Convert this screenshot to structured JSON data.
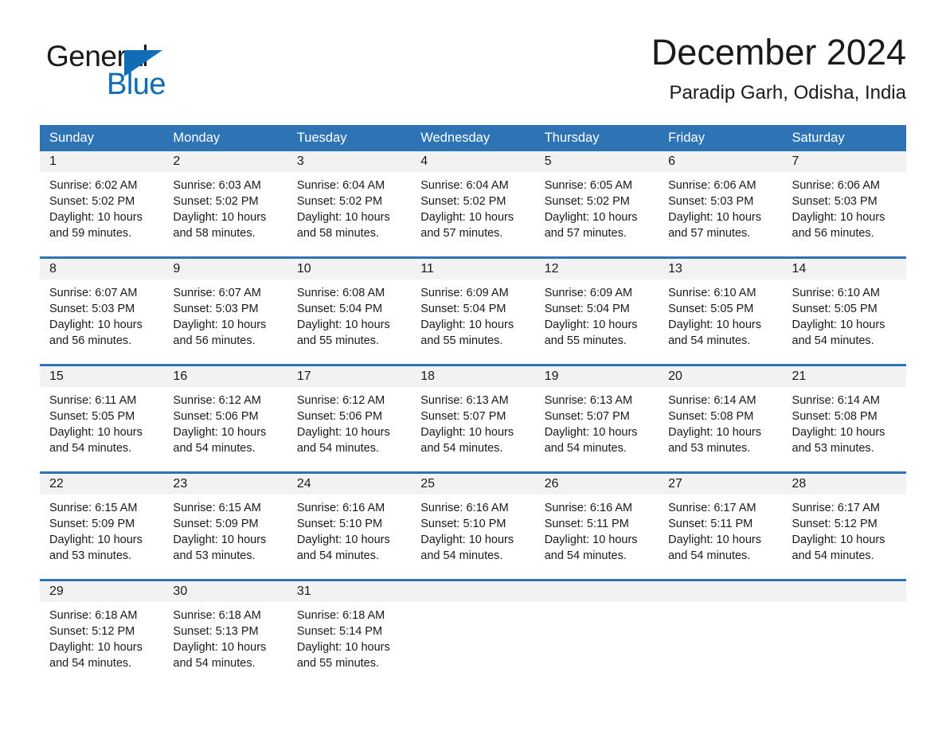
{
  "brand": {
    "name_part1": "General",
    "name_part2": "Blue",
    "triangle_color": "#0f6cb5"
  },
  "header": {
    "title": "December 2024",
    "location": "Paradip Garh, Odisha, India"
  },
  "theme": {
    "header_blue": "#2e74b5",
    "daynum_band": "#f2f2f2",
    "text": "#1a1a1a"
  },
  "weekdays": [
    "Sunday",
    "Monday",
    "Tuesday",
    "Wednesday",
    "Thursday",
    "Friday",
    "Saturday"
  ],
  "weeks": [
    [
      {
        "day": "1",
        "sunrise": "Sunrise: 6:02 AM",
        "sunset": "Sunset: 5:02 PM",
        "daylight_line1": "Daylight: 10 hours",
        "daylight_line2": "and 59 minutes."
      },
      {
        "day": "2",
        "sunrise": "Sunrise: 6:03 AM",
        "sunset": "Sunset: 5:02 PM",
        "daylight_line1": "Daylight: 10 hours",
        "daylight_line2": "and 58 minutes."
      },
      {
        "day": "3",
        "sunrise": "Sunrise: 6:04 AM",
        "sunset": "Sunset: 5:02 PM",
        "daylight_line1": "Daylight: 10 hours",
        "daylight_line2": "and 58 minutes."
      },
      {
        "day": "4",
        "sunrise": "Sunrise: 6:04 AM",
        "sunset": "Sunset: 5:02 PM",
        "daylight_line1": "Daylight: 10 hours",
        "daylight_line2": "and 57 minutes."
      },
      {
        "day": "5",
        "sunrise": "Sunrise: 6:05 AM",
        "sunset": "Sunset: 5:02 PM",
        "daylight_line1": "Daylight: 10 hours",
        "daylight_line2": "and 57 minutes."
      },
      {
        "day": "6",
        "sunrise": "Sunrise: 6:06 AM",
        "sunset": "Sunset: 5:03 PM",
        "daylight_line1": "Daylight: 10 hours",
        "daylight_line2": "and 57 minutes."
      },
      {
        "day": "7",
        "sunrise": "Sunrise: 6:06 AM",
        "sunset": "Sunset: 5:03 PM",
        "daylight_line1": "Daylight: 10 hours",
        "daylight_line2": "and 56 minutes."
      }
    ],
    [
      {
        "day": "8",
        "sunrise": "Sunrise: 6:07 AM",
        "sunset": "Sunset: 5:03 PM",
        "daylight_line1": "Daylight: 10 hours",
        "daylight_line2": "and 56 minutes."
      },
      {
        "day": "9",
        "sunrise": "Sunrise: 6:07 AM",
        "sunset": "Sunset: 5:03 PM",
        "daylight_line1": "Daylight: 10 hours",
        "daylight_line2": "and 56 minutes."
      },
      {
        "day": "10",
        "sunrise": "Sunrise: 6:08 AM",
        "sunset": "Sunset: 5:04 PM",
        "daylight_line1": "Daylight: 10 hours",
        "daylight_line2": "and 55 minutes."
      },
      {
        "day": "11",
        "sunrise": "Sunrise: 6:09 AM",
        "sunset": "Sunset: 5:04 PM",
        "daylight_line1": "Daylight: 10 hours",
        "daylight_line2": "and 55 minutes."
      },
      {
        "day": "12",
        "sunrise": "Sunrise: 6:09 AM",
        "sunset": "Sunset: 5:04 PM",
        "daylight_line1": "Daylight: 10 hours",
        "daylight_line2": "and 55 minutes."
      },
      {
        "day": "13",
        "sunrise": "Sunrise: 6:10 AM",
        "sunset": "Sunset: 5:05 PM",
        "daylight_line1": "Daylight: 10 hours",
        "daylight_line2": "and 54 minutes."
      },
      {
        "day": "14",
        "sunrise": "Sunrise: 6:10 AM",
        "sunset": "Sunset: 5:05 PM",
        "daylight_line1": "Daylight: 10 hours",
        "daylight_line2": "and 54 minutes."
      }
    ],
    [
      {
        "day": "15",
        "sunrise": "Sunrise: 6:11 AM",
        "sunset": "Sunset: 5:05 PM",
        "daylight_line1": "Daylight: 10 hours",
        "daylight_line2": "and 54 minutes."
      },
      {
        "day": "16",
        "sunrise": "Sunrise: 6:12 AM",
        "sunset": "Sunset: 5:06 PM",
        "daylight_line1": "Daylight: 10 hours",
        "daylight_line2": "and 54 minutes."
      },
      {
        "day": "17",
        "sunrise": "Sunrise: 6:12 AM",
        "sunset": "Sunset: 5:06 PM",
        "daylight_line1": "Daylight: 10 hours",
        "daylight_line2": "and 54 minutes."
      },
      {
        "day": "18",
        "sunrise": "Sunrise: 6:13 AM",
        "sunset": "Sunset: 5:07 PM",
        "daylight_line1": "Daylight: 10 hours",
        "daylight_line2": "and 54 minutes."
      },
      {
        "day": "19",
        "sunrise": "Sunrise: 6:13 AM",
        "sunset": "Sunset: 5:07 PM",
        "daylight_line1": "Daylight: 10 hours",
        "daylight_line2": "and 54 minutes."
      },
      {
        "day": "20",
        "sunrise": "Sunrise: 6:14 AM",
        "sunset": "Sunset: 5:08 PM",
        "daylight_line1": "Daylight: 10 hours",
        "daylight_line2": "and 53 minutes."
      },
      {
        "day": "21",
        "sunrise": "Sunrise: 6:14 AM",
        "sunset": "Sunset: 5:08 PM",
        "daylight_line1": "Daylight: 10 hours",
        "daylight_line2": "and 53 minutes."
      }
    ],
    [
      {
        "day": "22",
        "sunrise": "Sunrise: 6:15 AM",
        "sunset": "Sunset: 5:09 PM",
        "daylight_line1": "Daylight: 10 hours",
        "daylight_line2": "and 53 minutes."
      },
      {
        "day": "23",
        "sunrise": "Sunrise: 6:15 AM",
        "sunset": "Sunset: 5:09 PM",
        "daylight_line1": "Daylight: 10 hours",
        "daylight_line2": "and 53 minutes."
      },
      {
        "day": "24",
        "sunrise": "Sunrise: 6:16 AM",
        "sunset": "Sunset: 5:10 PM",
        "daylight_line1": "Daylight: 10 hours",
        "daylight_line2": "and 54 minutes."
      },
      {
        "day": "25",
        "sunrise": "Sunrise: 6:16 AM",
        "sunset": "Sunset: 5:10 PM",
        "daylight_line1": "Daylight: 10 hours",
        "daylight_line2": "and 54 minutes."
      },
      {
        "day": "26",
        "sunrise": "Sunrise: 6:16 AM",
        "sunset": "Sunset: 5:11 PM",
        "daylight_line1": "Daylight: 10 hours",
        "daylight_line2": "and 54 minutes."
      },
      {
        "day": "27",
        "sunrise": "Sunrise: 6:17 AM",
        "sunset": "Sunset: 5:11 PM",
        "daylight_line1": "Daylight: 10 hours",
        "daylight_line2": "and 54 minutes."
      },
      {
        "day": "28",
        "sunrise": "Sunrise: 6:17 AM",
        "sunset": "Sunset: 5:12 PM",
        "daylight_line1": "Daylight: 10 hours",
        "daylight_line2": "and 54 minutes."
      }
    ],
    [
      {
        "day": "29",
        "sunrise": "Sunrise: 6:18 AM",
        "sunset": "Sunset: 5:12 PM",
        "daylight_line1": "Daylight: 10 hours",
        "daylight_line2": "and 54 minutes."
      },
      {
        "day": "30",
        "sunrise": "Sunrise: 6:18 AM",
        "sunset": "Sunset: 5:13 PM",
        "daylight_line1": "Daylight: 10 hours",
        "daylight_line2": "and 54 minutes."
      },
      {
        "day": "31",
        "sunrise": "Sunrise: 6:18 AM",
        "sunset": "Sunset: 5:14 PM",
        "daylight_line1": "Daylight: 10 hours",
        "daylight_line2": "and 55 minutes."
      },
      {
        "day": "",
        "sunrise": "",
        "sunset": "",
        "daylight_line1": "",
        "daylight_line2": ""
      },
      {
        "day": "",
        "sunrise": "",
        "sunset": "",
        "daylight_line1": "",
        "daylight_line2": ""
      },
      {
        "day": "",
        "sunrise": "",
        "sunset": "",
        "daylight_line1": "",
        "daylight_line2": ""
      },
      {
        "day": "",
        "sunrise": "",
        "sunset": "",
        "daylight_line1": "",
        "daylight_line2": ""
      }
    ]
  ]
}
